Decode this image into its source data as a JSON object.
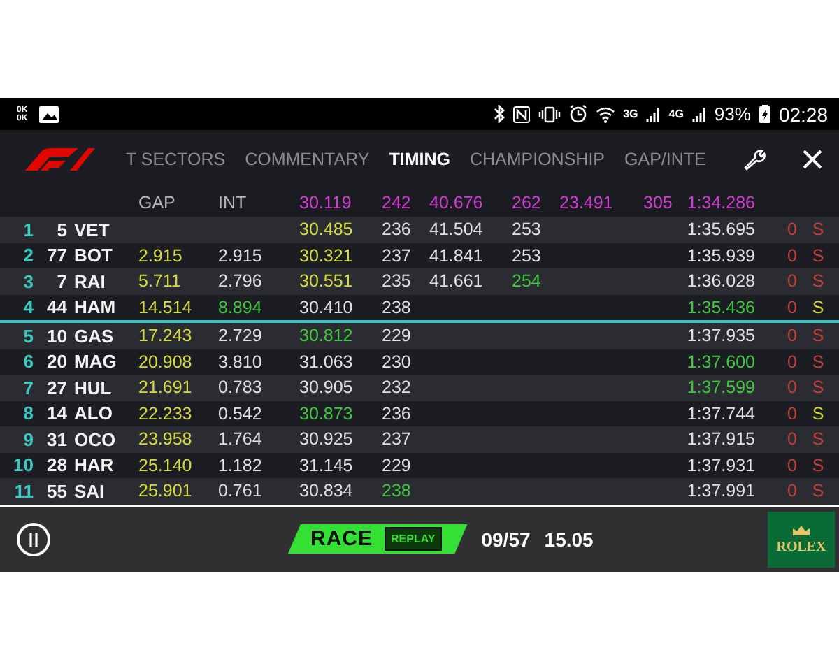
{
  "status_bar": {
    "net_speed": [
      "0K",
      "0K"
    ],
    "network_labels": [
      "3G",
      "4G"
    ],
    "battery": "93%",
    "time": "02:28"
  },
  "tabs": [
    {
      "label": "T SECTORS",
      "selected": false
    },
    {
      "label": "COMMENTARY",
      "selected": false
    },
    {
      "label": "TIMING",
      "selected": true
    },
    {
      "label": "CHAMPIONSHIP",
      "selected": false
    },
    {
      "label": "GAP/INTE",
      "selected": false
    }
  ],
  "table": {
    "header": {
      "gap": {
        "text": "GAP",
        "color": "#b4b4b8"
      },
      "interval": {
        "text": "INT",
        "color": "#b4b4b8"
      },
      "sector_1": {
        "text": "30.119",
        "color": "#d33ad3"
      },
      "speed_1": {
        "text": "242",
        "color": "#d33ad3"
      },
      "sector_2": {
        "text": "40.676",
        "color": "#d33ad3"
      },
      "speed_2": {
        "text": "262",
        "color": "#d33ad3"
      },
      "sector_3": {
        "text": "23.491",
        "color": "#d33ad3"
      },
      "speed_3": {
        "text": "305",
        "color": "#d33ad3"
      },
      "lap_time": {
        "text": "1:34.286",
        "color": "#d33ad3"
      }
    },
    "rows": [
      {
        "separator_above": false,
        "position": {
          "text": "1",
          "color": "#38c9c2"
        },
        "number": {
          "text": "5",
          "color": "#f2f2f2"
        },
        "driver": {
          "text": "VET",
          "color": "#f2f2f2"
        },
        "sector_1": {
          "text": "30.485",
          "color": "#d5db3c"
        },
        "speed_1": {
          "text": "236",
          "color": "#e0e0e0"
        },
        "sector_2": {
          "text": "41.504",
          "color": "#e0e0e0"
        },
        "speed_2": {
          "text": "253",
          "color": "#e0e0e0"
        },
        "lap_time": {
          "text": "1:35.695",
          "color": "#e0e0e0"
        },
        "pits": {
          "text": "0",
          "color": "#c2403d"
        },
        "tyre": {
          "text": "S",
          "color": "#c2403d"
        }
      },
      {
        "separator_above": false,
        "position": {
          "text": "2",
          "color": "#38c9c2"
        },
        "number": {
          "text": "77",
          "color": "#f2f2f2"
        },
        "driver": {
          "text": "BOT",
          "color": "#f2f2f2"
        },
        "gap": {
          "text": "2.915",
          "color": "#d5db3c"
        },
        "interval": {
          "text": "2.915",
          "color": "#e0e0e0"
        },
        "sector_1": {
          "text": "30.321",
          "color": "#d5db3c"
        },
        "speed_1": {
          "text": "237",
          "color": "#e0e0e0"
        },
        "sector_2": {
          "text": "41.841",
          "color": "#e0e0e0"
        },
        "speed_2": {
          "text": "253",
          "color": "#e0e0e0"
        },
        "lap_time": {
          "text": "1:35.939",
          "color": "#e0e0e0"
        },
        "pits": {
          "text": "0",
          "color": "#c2403d"
        },
        "tyre": {
          "text": "S",
          "color": "#c2403d"
        }
      },
      {
        "separator_above": false,
        "position": {
          "text": "3",
          "color": "#38c9c2"
        },
        "number": {
          "text": "7",
          "color": "#f2f2f2"
        },
        "driver": {
          "text": "RAI",
          "color": "#f2f2f2"
        },
        "gap": {
          "text": "5.711",
          "color": "#d5db3c"
        },
        "interval": {
          "text": "2.796",
          "color": "#e0e0e0"
        },
        "sector_1": {
          "text": "30.551",
          "color": "#d5db3c"
        },
        "speed_1": {
          "text": "235",
          "color": "#e0e0e0"
        },
        "sector_2": {
          "text": "41.661",
          "color": "#e0e0e0"
        },
        "speed_2": {
          "text": "254",
          "color": "#3fc83f"
        },
        "lap_time": {
          "text": "1:36.028",
          "color": "#e0e0e0"
        },
        "pits": {
          "text": "0",
          "color": "#c2403d"
        },
        "tyre": {
          "text": "S",
          "color": "#c2403d"
        }
      },
      {
        "separator_above": false,
        "position": {
          "text": "4",
          "color": "#38c9c2"
        },
        "number": {
          "text": "44",
          "color": "#f2f2f2"
        },
        "driver": {
          "text": "HAM",
          "color": "#f2f2f2"
        },
        "gap": {
          "text": "14.514",
          "color": "#d5db3c"
        },
        "interval": {
          "text": "8.894",
          "color": "#3fc83f"
        },
        "sector_1": {
          "text": "30.410",
          "color": "#e0e0e0"
        },
        "speed_1": {
          "text": "238",
          "color": "#e0e0e0"
        },
        "lap_time": {
          "text": "1:35.436",
          "color": "#3fc83f"
        },
        "pits": {
          "text": "0",
          "color": "#c2403d"
        },
        "tyre": {
          "text": "S",
          "color": "#d5d53c"
        }
      },
      {
        "separator_above": true,
        "position": {
          "text": "5",
          "color": "#38c9c2"
        },
        "number": {
          "text": "10",
          "color": "#f2f2f2"
        },
        "driver": {
          "text": "GAS",
          "color": "#f2f2f2"
        },
        "gap": {
          "text": "17.243",
          "color": "#d5db3c"
        },
        "interval": {
          "text": "2.729",
          "color": "#e0e0e0"
        },
        "sector_1": {
          "text": "30.812",
          "color": "#3fc83f"
        },
        "speed_1": {
          "text": "229",
          "color": "#e0e0e0"
        },
        "lap_time": {
          "text": "1:37.935",
          "color": "#e0e0e0"
        },
        "pits": {
          "text": "0",
          "color": "#c2403d"
        },
        "tyre": {
          "text": "S",
          "color": "#c2403d"
        }
      },
      {
        "separator_above": false,
        "position": {
          "text": "6",
          "color": "#38c9c2"
        },
        "number": {
          "text": "20",
          "color": "#f2f2f2"
        },
        "driver": {
          "text": "MAG",
          "color": "#f2f2f2"
        },
        "gap": {
          "text": "20.908",
          "color": "#d5db3c"
        },
        "interval": {
          "text": "3.810",
          "color": "#e0e0e0"
        },
        "sector_1": {
          "text": "31.063",
          "color": "#e0e0e0"
        },
        "speed_1": {
          "text": "230",
          "color": "#e0e0e0"
        },
        "lap_time": {
          "text": "1:37.600",
          "color": "#3fc83f"
        },
        "pits": {
          "text": "0",
          "color": "#c2403d"
        },
        "tyre": {
          "text": "S",
          "color": "#c2403d"
        }
      },
      {
        "separator_above": false,
        "position": {
          "text": "7",
          "color": "#38c9c2"
        },
        "number": {
          "text": "27",
          "color": "#f2f2f2"
        },
        "driver": {
          "text": "HUL",
          "color": "#f2f2f2"
        },
        "gap": {
          "text": "21.691",
          "color": "#d5db3c"
        },
        "interval": {
          "text": "0.783",
          "color": "#e0e0e0"
        },
        "sector_1": {
          "text": "30.905",
          "color": "#e0e0e0"
        },
        "speed_1": {
          "text": "232",
          "color": "#e0e0e0"
        },
        "lap_time": {
          "text": "1:37.599",
          "color": "#3fc83f"
        },
        "pits": {
          "text": "0",
          "color": "#c2403d"
        },
        "tyre": {
          "text": "S",
          "color": "#c2403d"
        }
      },
      {
        "separator_above": false,
        "position": {
          "text": "8",
          "color": "#38c9c2"
        },
        "number": {
          "text": "14",
          "color": "#f2f2f2"
        },
        "driver": {
          "text": "ALO",
          "color": "#f2f2f2"
        },
        "gap": {
          "text": "22.233",
          "color": "#d5db3c"
        },
        "interval": {
          "text": "0.542",
          "color": "#e0e0e0"
        },
        "sector_1": {
          "text": "30.873",
          "color": "#3fc83f"
        },
        "speed_1": {
          "text": "236",
          "color": "#e0e0e0"
        },
        "lap_time": {
          "text": "1:37.744",
          "color": "#e0e0e0"
        },
        "pits": {
          "text": "0",
          "color": "#c2403d"
        },
        "tyre": {
          "text": "S",
          "color": "#d5d53c"
        }
      },
      {
        "separator_above": false,
        "position": {
          "text": "9",
          "color": "#38c9c2"
        },
        "number": {
          "text": "31",
          "color": "#f2f2f2"
        },
        "driver": {
          "text": "OCO",
          "color": "#f2f2f2"
        },
        "gap": {
          "text": "23.958",
          "color": "#d5db3c"
        },
        "interval": {
          "text": "1.764",
          "color": "#e0e0e0"
        },
        "sector_1": {
          "text": "30.925",
          "color": "#e0e0e0"
        },
        "speed_1": {
          "text": "237",
          "color": "#e0e0e0"
        },
        "lap_time": {
          "text": "1:37.915",
          "color": "#e0e0e0"
        },
        "pits": {
          "text": "0",
          "color": "#c2403d"
        },
        "tyre": {
          "text": "S",
          "color": "#c2403d"
        }
      },
      {
        "separator_above": false,
        "position": {
          "text": "10",
          "color": "#38c9c2"
        },
        "number": {
          "text": "28",
          "color": "#f2f2f2"
        },
        "driver": {
          "text": "HAR",
          "color": "#f2f2f2"
        },
        "gap": {
          "text": "25.140",
          "color": "#d5db3c"
        },
        "interval": {
          "text": "1.182",
          "color": "#e0e0e0"
        },
        "sector_1": {
          "text": "31.145",
          "color": "#e0e0e0"
        },
        "speed_1": {
          "text": "229",
          "color": "#e0e0e0"
        },
        "lap_time": {
          "text": "1:37.931",
          "color": "#e0e0e0"
        },
        "pits": {
          "text": "0",
          "color": "#c2403d"
        },
        "tyre": {
          "text": "S",
          "color": "#c2403d"
        }
      },
      {
        "separator_above": false,
        "position": {
          "text": "11",
          "color": "#38c9c2"
        },
        "number": {
          "text": "55",
          "color": "#f2f2f2"
        },
        "driver": {
          "text": "SAI",
          "color": "#f2f2f2"
        },
        "gap": {
          "text": "25.901",
          "color": "#d5db3c"
        },
        "interval": {
          "text": "0.761",
          "color": "#e0e0e0"
        },
        "sector_1": {
          "text": "30.834",
          "color": "#e0e0e0"
        },
        "speed_1": {
          "text": "238",
          "color": "#3fc83f"
        },
        "lap_time": {
          "text": "1:37.991",
          "color": "#e0e0e0"
        },
        "pits": {
          "text": "0",
          "color": "#c2403d"
        },
        "tyre": {
          "text": "S",
          "color": "#c2403d"
        }
      }
    ]
  },
  "bottom_bar": {
    "session": "RACE",
    "mode": "REPLAY",
    "lap": "09/57",
    "clock": "15.05",
    "sponsor": "ROLEX"
  }
}
